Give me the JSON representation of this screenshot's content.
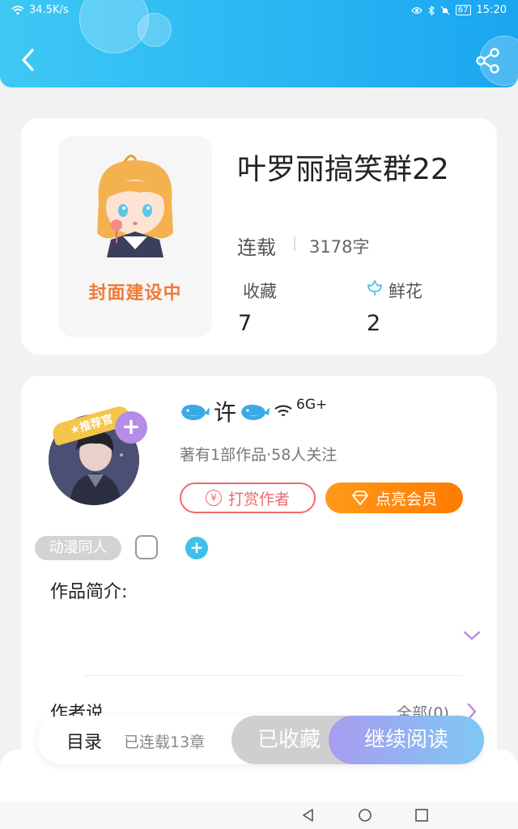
{
  "status_bar": {
    "speed": "34.5K/s",
    "battery": "67",
    "time": "15:20"
  },
  "book": {
    "cover_caption": "封面建设中",
    "title": "叶罗丽搞笑群22",
    "status": "连载",
    "word_count": "3178字",
    "favorites_label": "收藏",
    "favorites_count": "7",
    "flowers_label": "鲜花",
    "flowers_count": "2"
  },
  "author": {
    "badge": "推荐官",
    "name_char": "许",
    "network": "6G+",
    "meta": "著有1部作品·58人关注",
    "tip_label": "打赏作者",
    "vip_label": "点亮会员",
    "tag": "动漫同人"
  },
  "intro_label": "作品简介:",
  "author_says_label": "作者说",
  "all_link": "全部(0)",
  "bottom_bar": {
    "catalog": "目录",
    "chapters": "已连载13章",
    "favorited": "已收藏",
    "continue": "继续阅读"
  },
  "colors": {
    "header": "#29b7f3",
    "accent_orange": "#ff8a00",
    "tip_red": "#f06a6a",
    "purple": "#b58ce8"
  }
}
